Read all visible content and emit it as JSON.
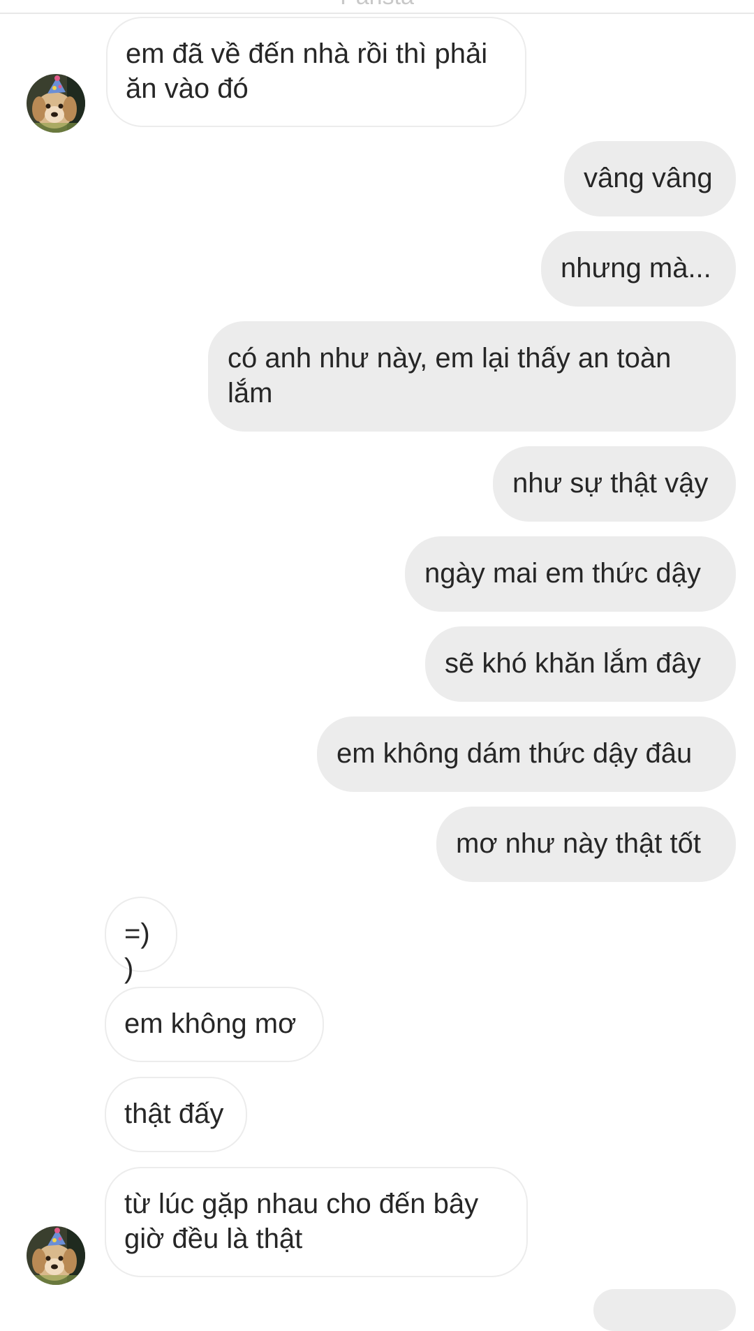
{
  "header": {
    "title": "Pahsta"
  },
  "contact": {
    "avatar_icon": "puppy-avatar-icon"
  },
  "messages": [
    {
      "sender": "them",
      "text": "em đã về đến nhà rồi thì phải ăn vào đó"
    },
    {
      "sender": "me",
      "text": "vâng vâng"
    },
    {
      "sender": "me",
      "text": "nhưng mà..."
    },
    {
      "sender": "me",
      "text": "có anh như này, em lại thấy an toàn lắm"
    },
    {
      "sender": "me",
      "text": "như sự thật vậy"
    },
    {
      "sender": "me",
      "text": "ngày mai em thức dậy"
    },
    {
      "sender": "me",
      "text": "sẽ khó khăn lắm đây"
    },
    {
      "sender": "me",
      "text": "em không dám thức dậy đâu"
    },
    {
      "sender": "me",
      "text": "mơ như này thật tốt"
    },
    {
      "sender": "them",
      "text": "=))"
    },
    {
      "sender": "them",
      "text": "em không mơ"
    },
    {
      "sender": "them",
      "text": "thật đấy"
    },
    {
      "sender": "them",
      "text": "từ lúc gặp nhau cho đến bây giờ đều là thật"
    }
  ],
  "colors": {
    "outgoing_bubble": "#ececec",
    "incoming_bubble": "#ffffff",
    "incoming_border": "#ececec",
    "text": "#262626"
  }
}
